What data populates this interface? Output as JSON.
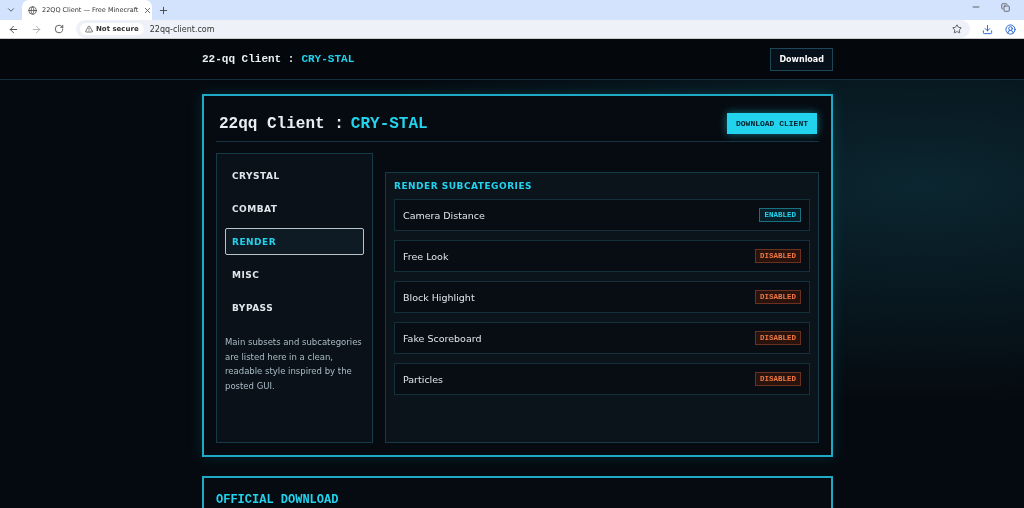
{
  "browser": {
    "tab_title": "22QQ Client — Free Minecraft",
    "security": "Not secure",
    "url": "22qq-client.com"
  },
  "site_header": {
    "brand": "22-qq Client :",
    "brand_accent": "CRY-STAL",
    "download_button": "Download"
  },
  "card": {
    "title": "22qq Client :",
    "title_accent": "CRY-STAL",
    "button": "DOWNLOAD CLIENT"
  },
  "sidebar": {
    "items": [
      {
        "label": "CRYSTAL",
        "selected": false
      },
      {
        "label": "COMBAT",
        "selected": false
      },
      {
        "label": "RENDER",
        "selected": true
      },
      {
        "label": "MISC",
        "selected": false
      },
      {
        "label": "BYPASS",
        "selected": false
      }
    ],
    "description": "Main subsets and subcategories are listed here in a clean, readable style inspired by the posted GUI."
  },
  "panel": {
    "heading": "RENDER SUBCATEGORIES",
    "rows": [
      {
        "name": "Camera Distance",
        "enabled": true,
        "status": "ENABLED"
      },
      {
        "name": "Free Look",
        "enabled": false,
        "status": "DISABLED"
      },
      {
        "name": "Block Highlight",
        "enabled": false,
        "status": "DISABLED"
      },
      {
        "name": "Fake Scoreboard",
        "enabled": false,
        "status": "DISABLED"
      },
      {
        "name": "Particles",
        "enabled": false,
        "status": "DISABLED"
      }
    ]
  },
  "next_section": {
    "title": "OFFICIAL DOWNLOAD"
  }
}
